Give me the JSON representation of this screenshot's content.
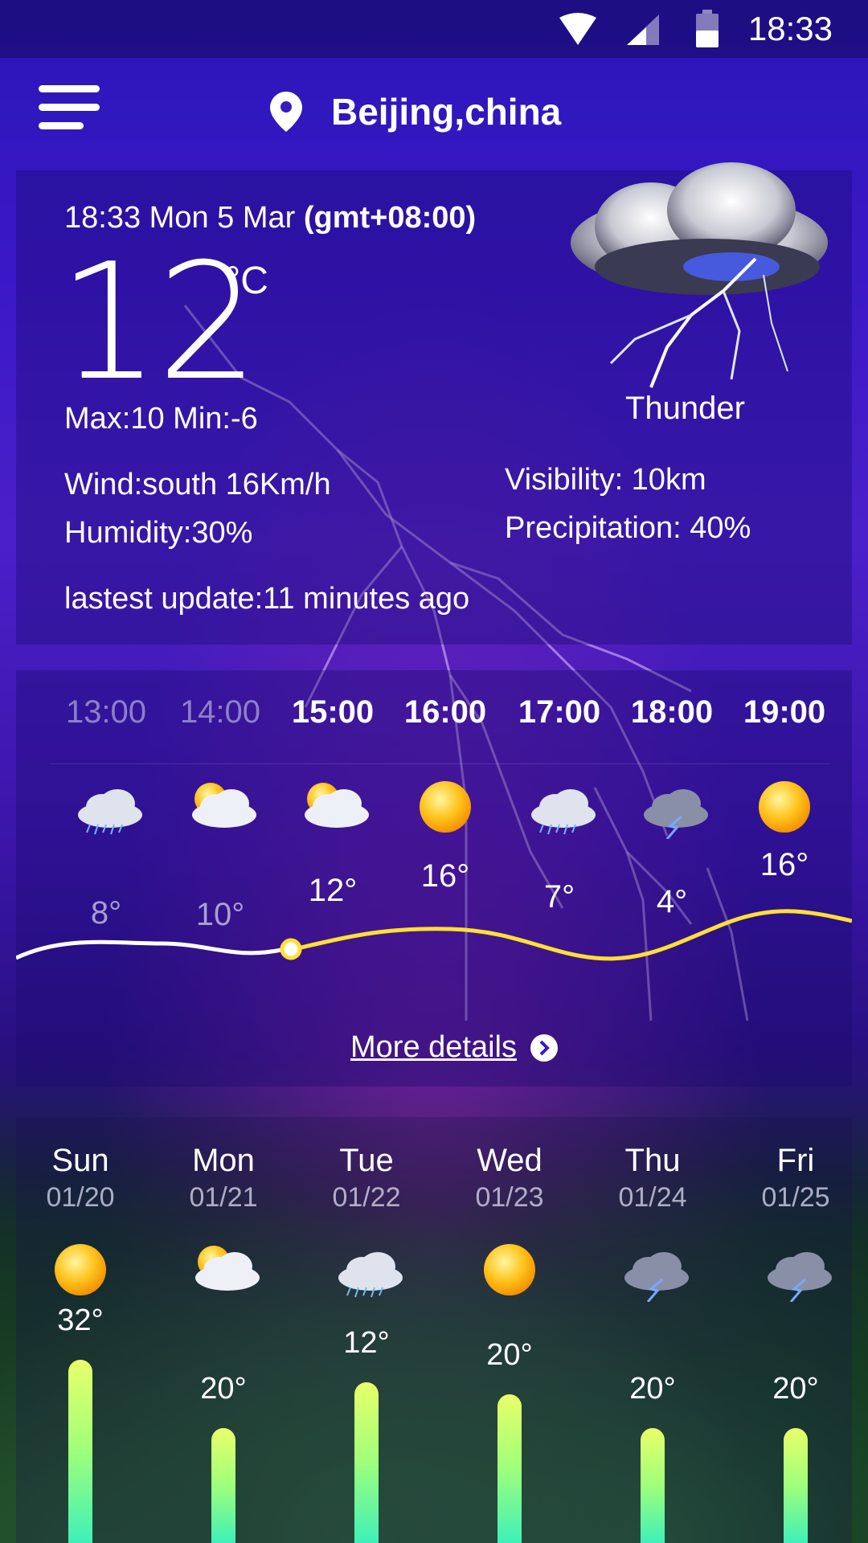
{
  "status_bar": {
    "time": "18:33"
  },
  "header": {
    "location": "Beijing,china"
  },
  "current": {
    "datetime": "18:33 Mon 5 Mar",
    "timezone": "(gmt+08:00)",
    "temperature": "12",
    "unit": "°C",
    "max_min": "Max:10  Min:-6",
    "condition": "Thunder",
    "wind": "Wind:south  16Km/h",
    "humidity": "Humidity:30%",
    "visibility": "Visibility: 10km",
    "precipitation": "Precipitation: 40%",
    "last_update": "lastest update:11 minutes ago"
  },
  "hourly": {
    "items": [
      {
        "time": "13:00",
        "icon": "rain-icon",
        "temp": "8°",
        "past": true
      },
      {
        "time": "14:00",
        "icon": "partly-cloudy-icon",
        "temp": "10°",
        "past": true
      },
      {
        "time": "15:00",
        "icon": "partly-cloudy-icon",
        "temp": "12°",
        "past": false
      },
      {
        "time": "16:00",
        "icon": "sun-icon",
        "temp": "16°",
        "past": false
      },
      {
        "time": "17:00",
        "icon": "rain-icon",
        "temp": "7°",
        "past": false
      },
      {
        "time": "18:00",
        "icon": "thunder-icon",
        "temp": "4°",
        "past": false
      },
      {
        "time": "19:00",
        "icon": "sun-icon",
        "temp": "16°",
        "past": false
      }
    ],
    "more_details": "More details"
  },
  "daily": {
    "items": [
      {
        "day": "Sun",
        "date": "01/20",
        "icon": "sun-icon",
        "temp": "32°",
        "value": 32
      },
      {
        "day": "Mon",
        "date": "01/21",
        "icon": "partly-cloudy-icon",
        "temp": "20°",
        "value": 20
      },
      {
        "day": "Tue",
        "date": "01/22",
        "icon": "rain-icon",
        "temp": "12°",
        "value": 28
      },
      {
        "day": "Wed",
        "date": "01/23",
        "icon": "sun-icon",
        "temp": "20°",
        "value": 26
      },
      {
        "day": "Thu",
        "date": "01/24",
        "icon": "thunder-icon",
        "temp": "20°",
        "value": 20
      },
      {
        "day": "Fri",
        "date": "01/25",
        "icon": "thunder-icon",
        "temp": "20°",
        "value": 20
      }
    ]
  }
}
